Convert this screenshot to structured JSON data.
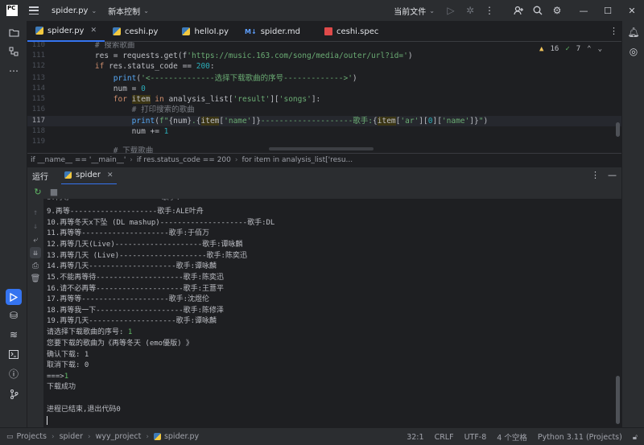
{
  "titlebar": {
    "logo_text": "PC",
    "project_name": "spider.py",
    "vcs_label": "新本控制",
    "run_config": "当前文件"
  },
  "tabs": [
    {
      "label": "spider.py",
      "type": "py",
      "active": true
    },
    {
      "label": "ceshi.py",
      "type": "py",
      "active": false
    },
    {
      "label": "helloI.py",
      "type": "py",
      "active": false
    },
    {
      "label": "spider.md",
      "type": "md",
      "active": false
    },
    {
      "label": "ceshi.spec",
      "type": "spec",
      "active": false
    }
  ],
  "editor": {
    "inspection_warnings": "16",
    "inspection_ok": "7",
    "current_line": 117,
    "line_numbers": [
      "110",
      "111",
      "112",
      "113",
      "114",
      "115",
      "116",
      "117",
      "118",
      "119"
    ]
  },
  "breadcrumbs": [
    "if __name__ == '__main__'",
    "if res.status_code == 200",
    "for item in analysis_list['resu..."
  ],
  "run_panel": {
    "title": "运行",
    "tab_label": "spider",
    "output": [
      "9.再等--------------------歌手:ALE叶舟",
      "10.再等冬天x下坠 (DL mashup)--------------------歌手:DL",
      "11.再等等--------------------歌手:于佰万",
      "12.再等几天(Live)--------------------歌手:谭咏麟",
      "13.再等几天 (Live)--------------------歌手:陈奕迅",
      "14.再等几天--------------------歌手:谭咏麟",
      "15.不能再等待--------------------歌手:陈奕迅",
      "16.请不必再等--------------------歌手:王薏平",
      "17.再等等--------------------歌手:沈煜伦",
      "18.再等我一下--------------------歌手:陈修泽",
      "19.再等几天--------------------歌手:谭咏麟",
      "请选择下载歌曲的序号: ",
      "您要下载的歌曲为《再等冬天 (emo優版) 》",
      "确认下载: 1",
      "取消下载: 0",
      "===>",
      "下载成功",
      "",
      "进程已结束,退出代码0"
    ],
    "input_echo_1": "1",
    "input_echo_2": "1"
  },
  "status": {
    "breadcrumb": [
      "Projects",
      "spider",
      "wyy_project",
      "spider.py"
    ],
    "position": "32:1",
    "line_sep": "CRLF",
    "encoding": "UTF-8",
    "indent": "4 个空格",
    "interpreter": "Python 3.11 (Projects)"
  },
  "icons": {
    "menu": "hamburger-icon",
    "run": "play-icon",
    "debug": "bug-icon",
    "more": "more-vertical-icon",
    "add_user": "add-user-icon",
    "search": "search-icon",
    "settings": "gear-icon"
  },
  "colors": {
    "accent": "#3574f0",
    "keyword": "#cf8e6d",
    "string": "#6aab73",
    "number": "#2aacb8",
    "comment": "#7a7e85"
  }
}
